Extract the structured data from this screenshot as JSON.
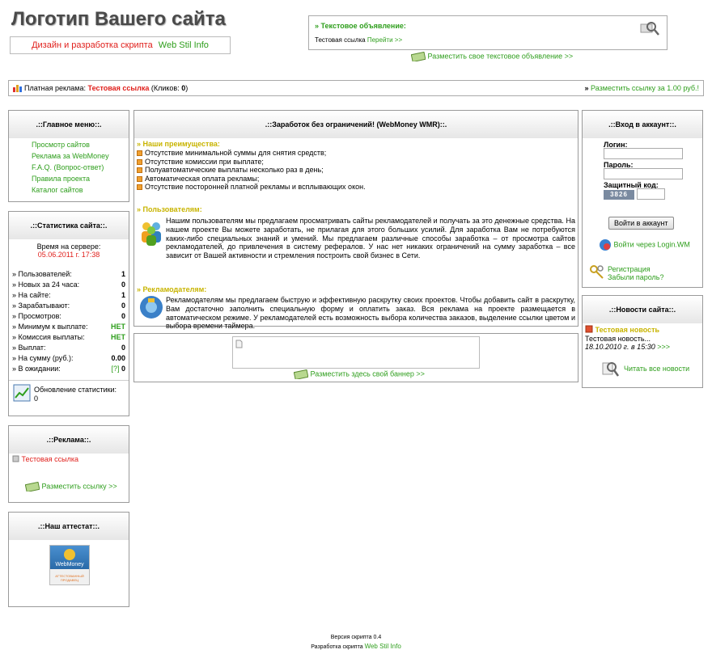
{
  "header": {
    "logo": "Логотип Вашего сайта",
    "subtitle_red": "Дизайн и разработка скрипта",
    "subtitle_green": "Web Stil Info",
    "ad_title": "» Текстовое объявление:",
    "ad_text": "Тестовая ссылка",
    "ad_link": "Перейти >>",
    "place_ad": "Разместить свое текстовое объявление >>"
  },
  "paid_bar": {
    "label": "Платная реклама:",
    "link": "Тестовая ссылка",
    "clicks_pre": "(Кликов:",
    "clicks": "0",
    "clicks_post": ")",
    "place_link": "Разместить ссылку за 1.00 руб.!"
  },
  "main_menu": {
    "title": ".::Главное меню::.",
    "items": [
      "Просмотр сайтов",
      "Реклама за WebMoney",
      "F.A.Q. (Вопрос-ответ)",
      "Правила проекта",
      "Каталог сайтов"
    ]
  },
  "stats": {
    "title": ".::Статистика сайта::.",
    "server_time_label": "Время на сервере:",
    "server_time": "05.06.2011 г. 17:38",
    "rows": [
      {
        "label": "» Пользователей:",
        "value": "1"
      },
      {
        "label": "» Новых за 24 часа:",
        "value": "0"
      },
      {
        "label": "» На сайте:",
        "value": "1"
      },
      {
        "label": "» Зарабатывают:",
        "value": "0"
      },
      {
        "label": "» Просмотров:",
        "value": "0"
      },
      {
        "label": "» Минимум к выплате:",
        "value": "НЕТ"
      },
      {
        "label": "» Комиссия выплаты:",
        "value": "НЕТ"
      },
      {
        "label": "» Выплат:",
        "value": "0"
      },
      {
        "label": "» На сумму (руб.):",
        "value": "0.00"
      },
      {
        "label": "» В ожидании:",
        "value": "0",
        "extra": "[?]"
      }
    ],
    "update_label": "Обновление статистики:",
    "update_value": "0"
  },
  "ads_panel": {
    "title": ".::Реклама::.",
    "link": "Тестовая ссылка",
    "place": "Разместить ссылку >>"
  },
  "attest": {
    "title": ".::Наш аттестат::.",
    "badge_top": "WebMoney",
    "badge_bottom": "АТТЕСТОВАННЫЙ ПРОДАВЕЦ"
  },
  "center": {
    "title": ".::Заработок без ограничений! (WebMoney WMR)::.",
    "adv_title": "» Наши преимущества:",
    "adv_items": [
      "Отсутствие минимальной суммы для снятия средств;",
      "Отсутствие комиссии при выплате;",
      "Полуавтоматические выплаты несколько раз в день;",
      "Автоматическая оплата рекламы;",
      "Отсутствие посторонней платной рекламы и всплывающих окон."
    ],
    "users_title": "» Пользователям:",
    "users_text": "Нашим пользователям мы предлагаем просматривать сайты рекламодателей и получать за это денежные средства. На нашем проекте Вы можете заработать, не прилагая для этого больших усилий. Для заработка Вам не потребуются каких-либо специальных знаний и умений. Мы предлагаем различные способы заработка – от просмотра сайтов рекламодателей, до привлечения в систему рефералов. У нас нет никаких ограничений на сумму заработка – все зависит от Вашей активности и стремления построить свой бизнес в Сети.",
    "adv2_title": "» Рекламодателям:",
    "adv2_text": "Рекламодателям мы предлагаем быструю и эффективную раскрутку своих проектов. Чтобы добавить сайт в раскрутку, Вам достаточно заполнить специальную форму и оплатить заказ. Вся реклама на проекте размещается в автоматическом режиме. У рекламодателей есть возможность выбора количества заказов, выделение ссылки цветом и выбора времени таймера.",
    "banner_link": "Разместить здесь свой баннер >>"
  },
  "login": {
    "title": ".::Вход в аккаунт::.",
    "login_label": "Логин:",
    "password_label": "Пароль:",
    "captcha_label": "Защитный код:",
    "captcha_value": "3826",
    "submit": "Войти в аккаунт",
    "login_wm": "Войти через Login.WM",
    "register": "Регистрация",
    "forgot": "Забыли пароль?"
  },
  "news": {
    "title": ".::Новости сайта::.",
    "item_title": "Тестовая новость",
    "item_text": "Тестовая новость...",
    "item_date": "18.10.2010 г. в 15:30",
    "item_more": ">>>",
    "all_news": "Читать все новости"
  },
  "footer": {
    "version": "Версия скрипта 0.4",
    "dev_label": "Разработка скрипта",
    "dev_link": "Web Stil Info"
  }
}
